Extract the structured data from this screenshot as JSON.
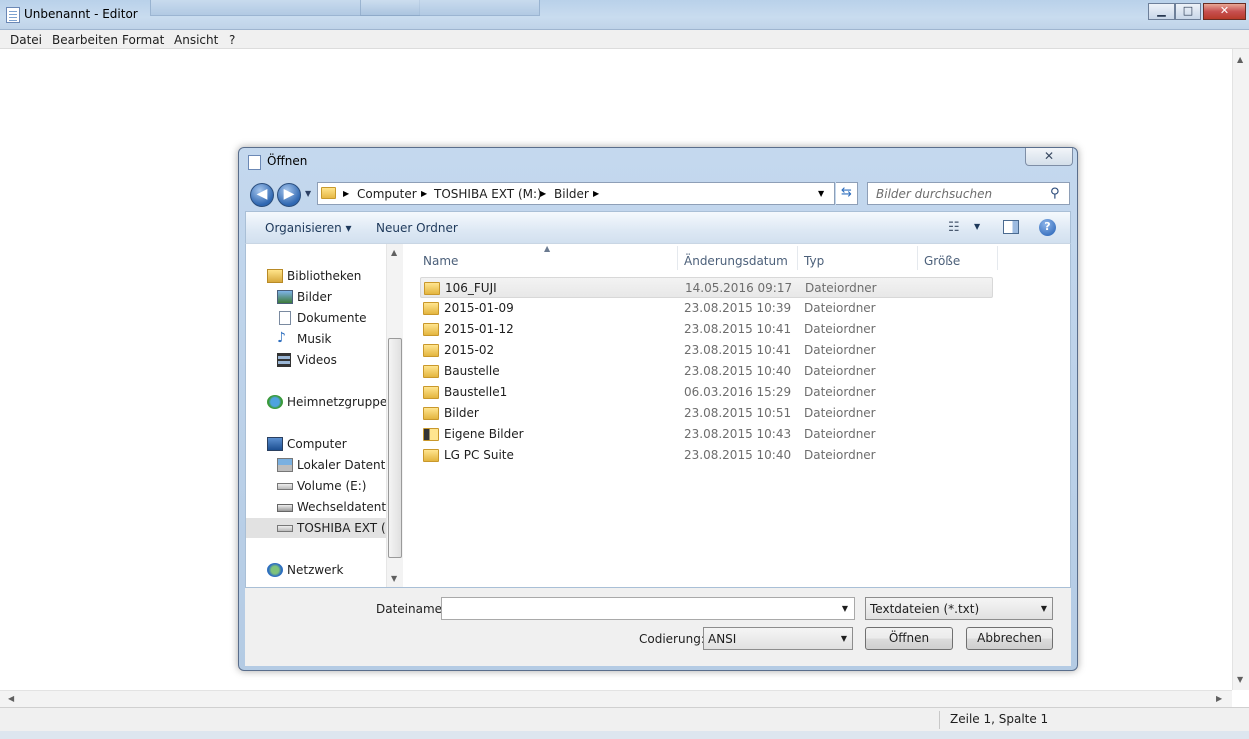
{
  "window": {
    "title": "Unbenannt - Editor",
    "controls": {
      "minimize": "▁",
      "maximize": "□",
      "close": "✕"
    }
  },
  "menubar": {
    "items": [
      "Datei",
      "Bearbeiten",
      "Format",
      "Ansicht",
      "?"
    ]
  },
  "statusbar": {
    "position": "Zeile 1, Spalte 1"
  },
  "dialog": {
    "title": "Öffnen",
    "close": "✕",
    "nav": {
      "back": "◀",
      "forward": "▶"
    },
    "breadcrumb": [
      "Computer",
      "TOSHIBA EXT (M:)",
      "Bilder"
    ],
    "search_placeholder": "Bilder durchsuchen",
    "toolbar": {
      "organize": "Organisieren ▾",
      "new_folder": "Neuer Ordner"
    },
    "nav_pane": [
      {
        "label": "Bibliotheken",
        "icon": "libraries-icon"
      },
      {
        "label": "Bilder",
        "icon": "pictures-library-icon"
      },
      {
        "label": "Dokumente",
        "icon": "documents-library-icon"
      },
      {
        "label": "Musik",
        "icon": "music-library-icon"
      },
      {
        "label": "Videos",
        "icon": "videos-library-icon"
      },
      {
        "label": "Heimnetzgruppe",
        "icon": "homegroup-icon"
      },
      {
        "label": "Computer",
        "icon": "computer-icon"
      },
      {
        "label": "Lokaler Datenträger (C:)",
        "icon": "local-disk-icon"
      },
      {
        "label": "Volume (E:)",
        "icon": "drive-icon"
      },
      {
        "label": "Wechseldatenträger",
        "icon": "removable-drive-icon"
      },
      {
        "label": "TOSHIBA EXT (M:)",
        "icon": "drive-icon",
        "selected": true
      },
      {
        "label": "Netzwerk",
        "icon": "network-icon"
      }
    ],
    "columns": [
      "Name",
      "Änderungsdatum",
      "Typ",
      "Größe"
    ],
    "files": [
      {
        "name": "106_FUJI",
        "date": "14.05.2016 09:17",
        "type": "Dateiordner",
        "selected": true
      },
      {
        "name": "2015-01-09",
        "date": "23.08.2015 10:39",
        "type": "Dateiordner"
      },
      {
        "name": "2015-01-12",
        "date": "23.08.2015 10:41",
        "type": "Dateiordner"
      },
      {
        "name": "2015-02",
        "date": "23.08.2015 10:41",
        "type": "Dateiordner"
      },
      {
        "name": "Baustelle",
        "date": "23.08.2015 10:40",
        "type": "Dateiordner"
      },
      {
        "name": "Baustelle1",
        "date": "06.03.2016 15:29",
        "type": "Dateiordner"
      },
      {
        "name": "Bilder",
        "date": "23.08.2015 10:51",
        "type": "Dateiordner"
      },
      {
        "name": "Eigene Bilder",
        "date": "23.08.2015 10:43",
        "type": "Dateiordner"
      },
      {
        "name": "LG PC Suite",
        "date": "23.08.2015 10:40",
        "type": "Dateiordner"
      }
    ],
    "filename_label": "Dateiname:",
    "filename_value": "",
    "filetype": "Textdateien (*.txt)",
    "encoding_label": "Codierung:",
    "encoding": "ANSI",
    "open_button": "Öffnen",
    "cancel_button": "Abbrechen"
  }
}
